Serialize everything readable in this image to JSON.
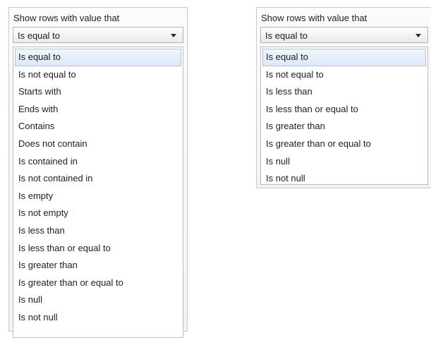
{
  "left_filter": {
    "caption": "Show rows with value that",
    "selected_value": "Is equal to",
    "options": [
      "Is equal to",
      "Is not equal to",
      "Starts with",
      "Ends with",
      "Contains",
      "Does not contain",
      "Is contained in",
      "Is not contained in",
      "Is empty",
      "Is not empty",
      "Is less than",
      "Is less than or equal to",
      "Is greater than",
      "Is greater than or equal to",
      "Is null",
      "Is not null"
    ],
    "highlighted_index": 0
  },
  "right_filter": {
    "caption": "Show rows with value that",
    "selected_value": "Is equal to",
    "options": [
      "Is equal to",
      "Is not equal to",
      "Is less than",
      "Is less than or equal to",
      "Is greater than",
      "Is greater than or equal to",
      "Is null",
      "Is not null"
    ],
    "highlighted_index": 0
  },
  "icons": {
    "dropdown_caret": "chevron-down-icon"
  },
  "colors": {
    "highlight_bg": "#dde9f7",
    "highlight_border": "#a9c3e3",
    "panel_border": "#c6ccd4"
  }
}
